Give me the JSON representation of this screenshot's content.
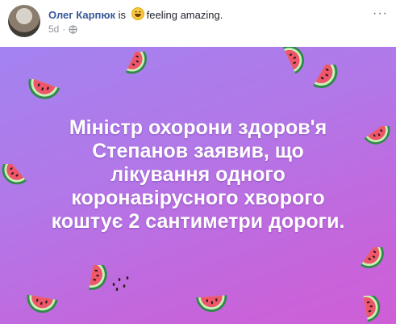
{
  "post": {
    "author": "Олег Карпюк",
    "is_text": "is",
    "feeling_text": "feeling amazing.",
    "timestamp": "5d",
    "more_symbol": "···"
  },
  "image": {
    "lines": [
      "Міністр охорони здоров'я",
      "Степанов заявив, що",
      "лікування одного",
      "коронавірусного хворого",
      "коштує 2 сантиметри дороги."
    ]
  },
  "colors": {
    "author_link": "#385898",
    "background_start": "#a383f0",
    "background_end": "#cf5ed6",
    "text": "#ffffff"
  },
  "icons": [
    "avatar",
    "smiley-emoji-icon",
    "globe-icon",
    "more-options-icon",
    "watermelon-slice-icon"
  ]
}
